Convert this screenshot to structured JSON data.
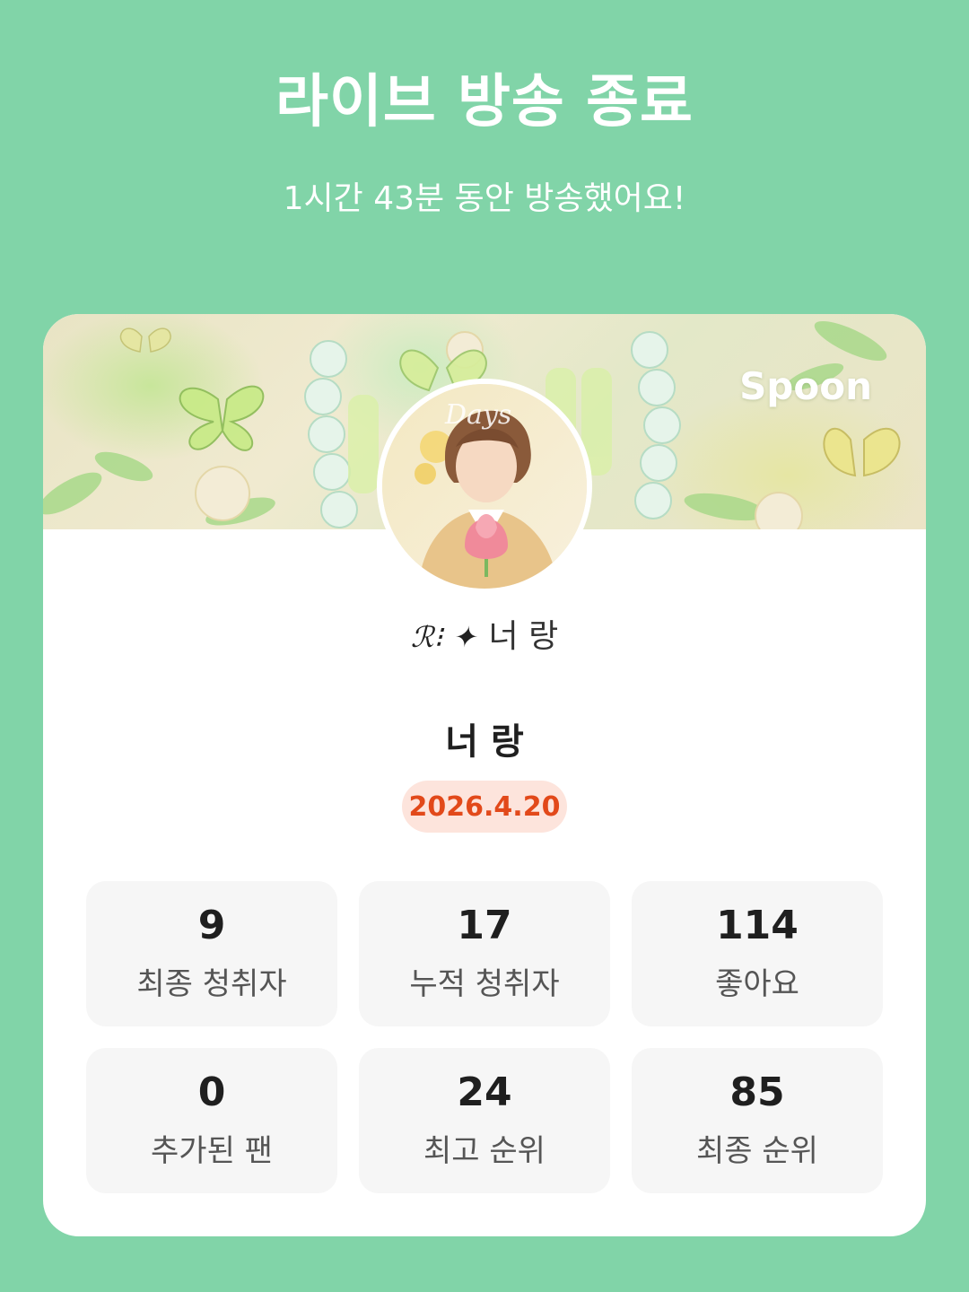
{
  "header": {
    "title": "라이브 방송 종료",
    "subtitle": "1시간 43분 동안 방송했어요!"
  },
  "card": {
    "banner": {
      "brand_logo": "Spoon",
      "icon_names": [
        "butterfly-icon",
        "flower-icon"
      ]
    },
    "profile": {
      "nickname_mark": "ℛ⁝ ✦",
      "nickname": "너 랑",
      "dj_name": "너 랑",
      "date": "2026.4.20"
    },
    "stats": [
      {
        "value": "9",
        "label": "최종 청취자"
      },
      {
        "value": "17",
        "label": "누적 청취자"
      },
      {
        "value": "114",
        "label": "좋아요"
      },
      {
        "value": "0",
        "label": "추가된 팬"
      },
      {
        "value": "24",
        "label": "최고 순위"
      },
      {
        "value": "85",
        "label": "최종 순위"
      }
    ]
  },
  "colors": {
    "background": "#81d4a8",
    "card": "#ffffff",
    "date_badge_bg": "#fde4dc",
    "date_badge_text": "#e2491a",
    "stat_tile_bg": "#f6f6f6"
  }
}
